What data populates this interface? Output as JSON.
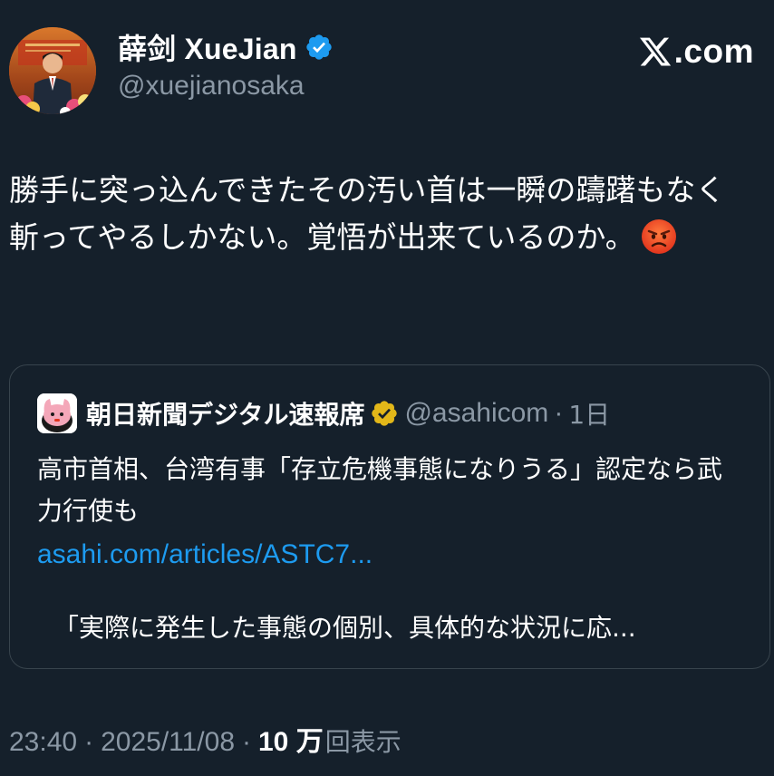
{
  "author": {
    "display_name": "薛剑 XueJian",
    "handle": "@xuejianosaka",
    "verified_badge_icon": "blue-verified-check-icon"
  },
  "site": {
    "logo_icon": "x-logo-icon",
    "domain": ".com"
  },
  "tweet": {
    "text": "勝手に突っ込んできたその汚い首は一瞬の躊躇もなく斬ってやるしかない。覚悟が出来ているのか。",
    "emoji_icon": "angry-face-icon"
  },
  "quoted": {
    "display_name": "朝日新聞デジタル速報席",
    "verified_badge_icon": "gold-verified-check-icon",
    "handle": "@asahicom",
    "separator": "·",
    "time": "1日",
    "headline": "高市首相、台湾有事「存立危機事態になりうる」認定なら武力行使も",
    "link": "asahi.com/articles/ASTC7...",
    "excerpt": "「実際に発生した事態の個別、具体的な状況に応..."
  },
  "meta": {
    "time": "23:40",
    "separator": "·",
    "date": "2025/11/08",
    "separator2": "·",
    "views_count": "10 万",
    "views_label": "回表示"
  },
  "colors": {
    "background": "#15202b",
    "secondary_text": "#8b98a5",
    "link": "#1d9bf0",
    "border": "#38444d",
    "verified_blue": "#1d9bf0",
    "verified_gold": "#e2b719"
  }
}
